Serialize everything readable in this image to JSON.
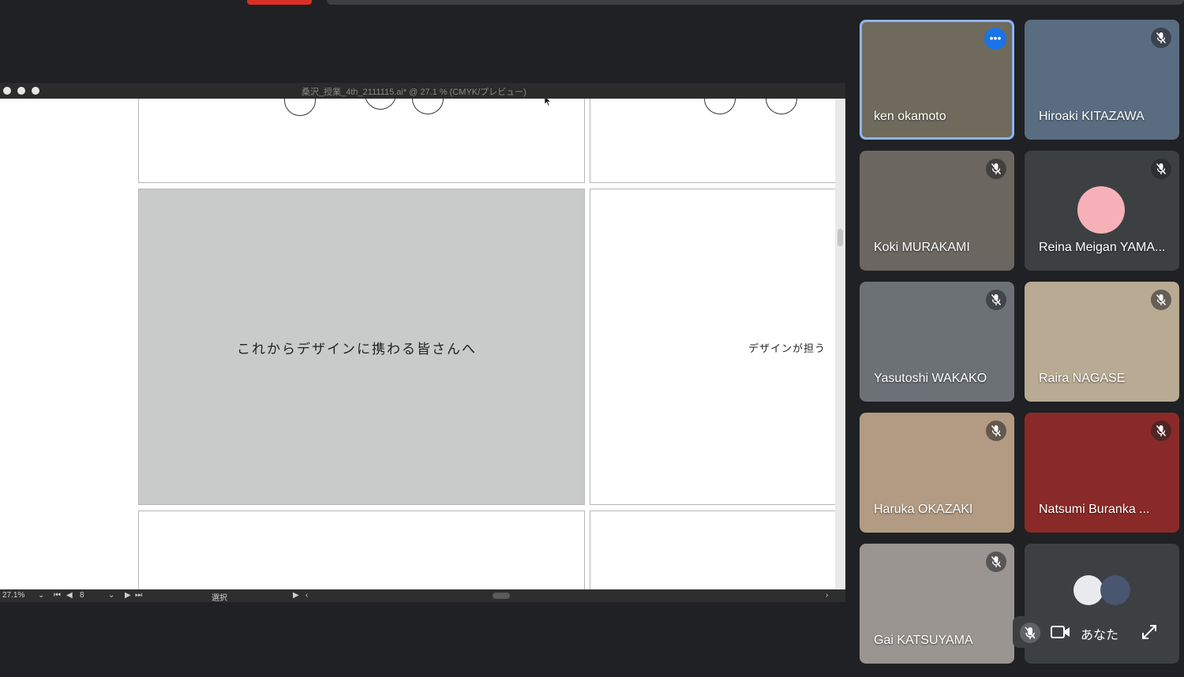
{
  "illustrator": {
    "title": "桑沢_授業_4th_2111115.ai* @ 27.1 % (CMYK/プレビュー)",
    "artboard_main_text": "これからデザインに携わる皆さんへ",
    "artboard_right_text": "デザインが担う",
    "status": {
      "zoom": "27.1%",
      "artboard_number": "8",
      "tool": "選択"
    }
  },
  "participants": [
    {
      "name": "ken okamoto",
      "speaking": true,
      "muted": false,
      "bg": "#6f6a5c"
    },
    {
      "name": "Hiroaki KITAZAWA",
      "muted": true,
      "bg": "#5a6d80"
    },
    {
      "name": "Koki MURAKAMI",
      "muted": true,
      "bg": "#6b6660"
    },
    {
      "name": "Reina Meigan YAMA...",
      "muted": true,
      "bg": "#3c4043",
      "avatar": true
    },
    {
      "name": "Yasutoshi WAKAKO",
      "muted": true,
      "bg": "#6c7176"
    },
    {
      "name": "Raira NAGASE",
      "muted": true,
      "bg": "#b9aa94"
    },
    {
      "name": "Haruka OKAZAKI",
      "muted": true,
      "bg": "#b29b82"
    },
    {
      "name": "Natsumi Buranka ...",
      "muted": true,
      "bg": "#8a2a28"
    },
    {
      "name": "Gai KATSUYAMA",
      "muted": true,
      "bg": "#9a9590"
    },
    {
      "name": "",
      "muted": false,
      "bg": "#3c4043",
      "self": true
    }
  ],
  "self_view": {
    "label": "あなた"
  },
  "icons": {
    "speaking": "more-options-icon",
    "muted": "mic-off-icon",
    "camera": "camera-icon",
    "expand": "expand-icon"
  }
}
